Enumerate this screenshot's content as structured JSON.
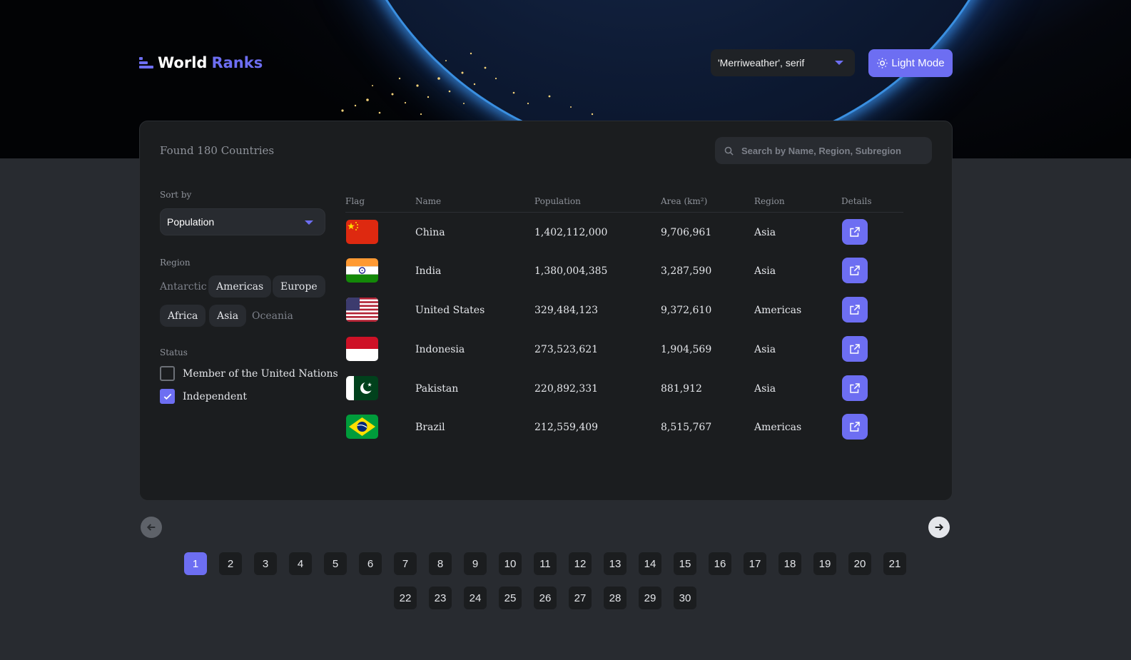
{
  "header": {
    "logo_word1": "World",
    "logo_word2": "Ranks",
    "font_select_value": "'Merriweather', serif",
    "theme_button_label": "Light Mode"
  },
  "summary": {
    "found_text": "Found 180 Countries"
  },
  "search": {
    "placeholder": "Search by Name, Region, Subregion"
  },
  "filters": {
    "sort_label": "Sort by",
    "sort_value": "Population",
    "region_label": "Region",
    "regions": [
      {
        "label": "Antarctic",
        "selected": false
      },
      {
        "label": "Americas",
        "selected": true
      },
      {
        "label": "Europe",
        "selected": true
      },
      {
        "label": "Africa",
        "selected": true
      },
      {
        "label": "Asia",
        "selected": true
      },
      {
        "label": "Oceania",
        "selected": false
      }
    ],
    "status_label": "Status",
    "statuses": [
      {
        "label": "Member of the United Nations",
        "checked": false
      },
      {
        "label": "Independent",
        "checked": true
      }
    ]
  },
  "table": {
    "columns": [
      "Flag",
      "Name",
      "Population",
      "Area (km²)",
      "Region",
      "Details"
    ],
    "rows": [
      {
        "flag": "china-flag",
        "name": "China",
        "population": "1,402,112,000",
        "area": "9,706,961",
        "region": "Asia"
      },
      {
        "flag": "india-flag",
        "name": "India",
        "population": "1,380,004,385",
        "area": "3,287,590",
        "region": "Asia"
      },
      {
        "flag": "usa-flag",
        "name": "United States",
        "population": "329,484,123",
        "area": "9,372,610",
        "region": "Americas"
      },
      {
        "flag": "indonesia-flag",
        "name": "Indonesia",
        "population": "273,523,621",
        "area": "1,904,569",
        "region": "Asia"
      },
      {
        "flag": "pakistan-flag",
        "name": "Pakistan",
        "population": "220,892,331",
        "area": "881,912",
        "region": "Asia"
      },
      {
        "flag": "brazil-flag",
        "name": "Brazil",
        "population": "212,559,409",
        "area": "8,515,767",
        "region": "Americas"
      }
    ]
  },
  "pagination": {
    "current": "1",
    "pages": [
      "1",
      "2",
      "3",
      "4",
      "5",
      "6",
      "7",
      "8",
      "9",
      "10",
      "11",
      "12",
      "13",
      "14",
      "15",
      "16",
      "17",
      "18",
      "19",
      "20",
      "21",
      "22",
      "23",
      "24",
      "25",
      "26",
      "27",
      "28",
      "29",
      "30"
    ]
  },
  "colors": {
    "accent": "#6d6ef2",
    "background": "#282b30",
    "card": "#1b1d1f"
  }
}
